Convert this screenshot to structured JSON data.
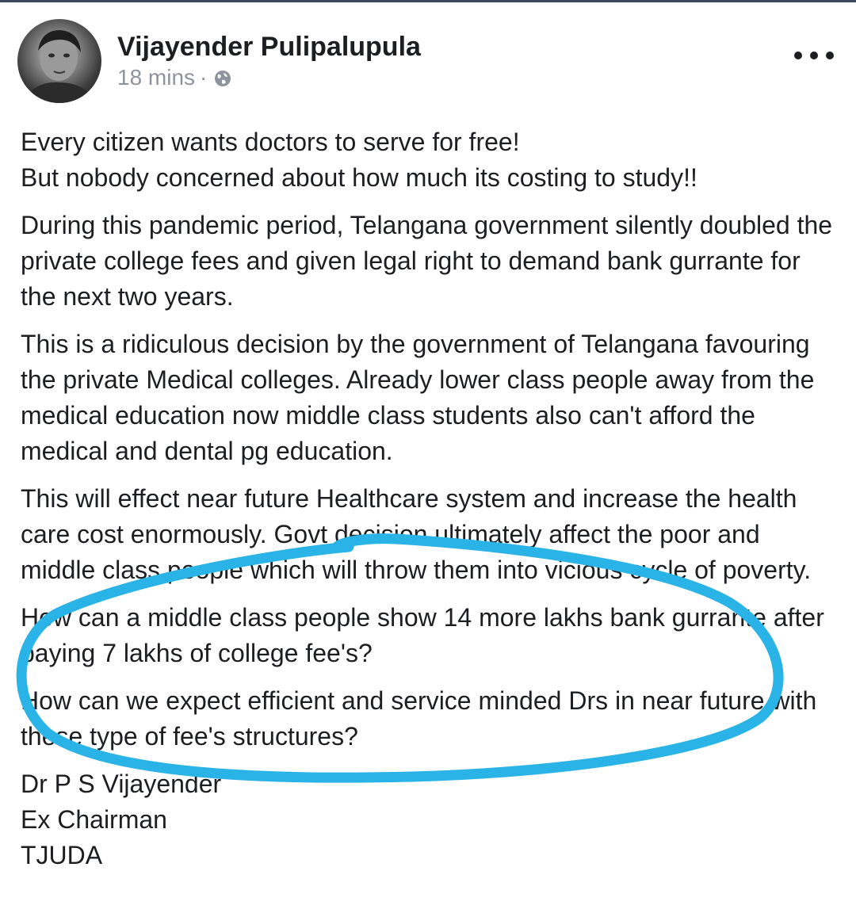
{
  "post": {
    "author": "Vijayender Pulipalupula",
    "time": "18 mins",
    "separator": "·",
    "privacy_icon": "globe-icon",
    "more_icon": "more-options-icon",
    "paragraphs": [
      "Every citizen wants doctors to serve for free!\nBut nobody concerned about how much its costing to study!!",
      "During this pandemic period, Telangana government silently doubled the private college fees and given legal right to demand bank gurrante for the next two years.",
      "This is a ridiculous decision by the government of Telangana favouring the private Medical colleges. Already lower class people away from the medical education now middle class students also can't afford the medical and dental pg education.",
      "This will effect near future Healthcare system and increase the health care cost enormously. Govt decision ultimately affect the poor and middle class people which will throw them into vicious cycle of poverty.",
      "How can a middle class people show 14 more lakhs bank gurrante after paying 7 lakhs of college fee's?",
      "How can we expect efficient and service minded Drs in near future with these type of fee's structures?"
    ],
    "signature": "Dr P S Vijayender\nEx Chairman\nTJUDA"
  },
  "colors": {
    "text": "#1c1e21",
    "meta": "#8d949e",
    "annotation": "#2ab3e6"
  }
}
